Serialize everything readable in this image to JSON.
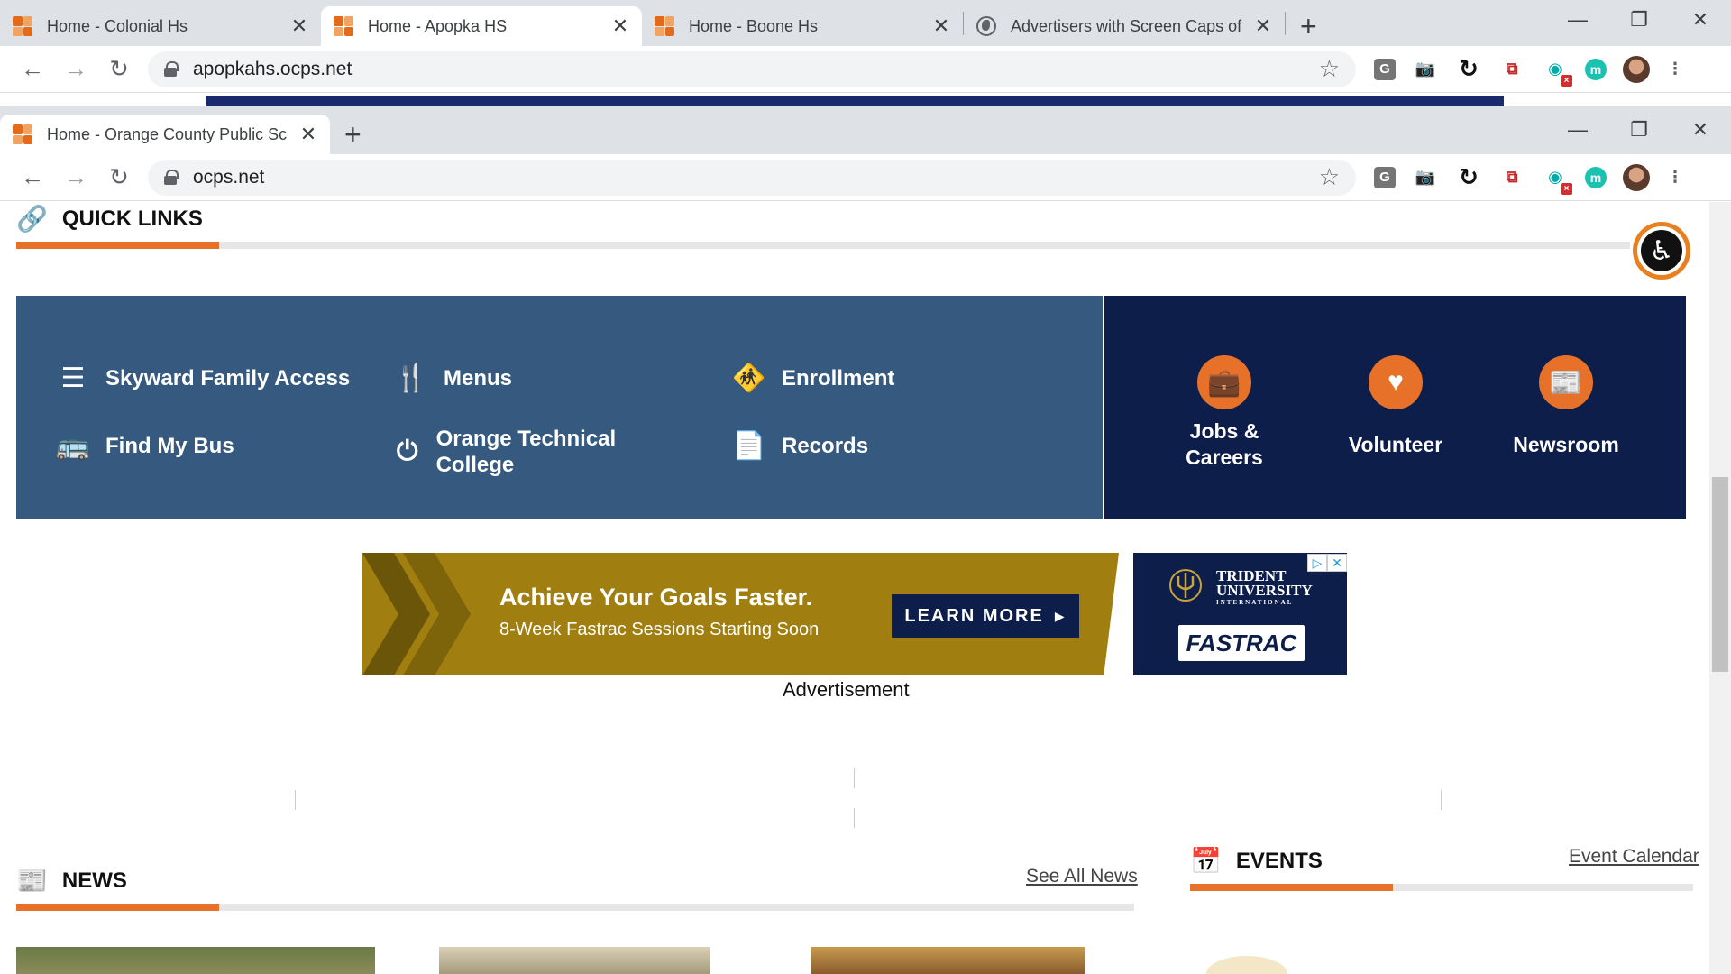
{
  "window1": {
    "tabs": [
      {
        "title": "Home - Colonial Hs",
        "active": false
      },
      {
        "title": "Home - Apopka HS",
        "active": true
      },
      {
        "title": "Home - Boone Hs",
        "active": false
      },
      {
        "title": "Advertisers with Screen Caps of t",
        "active": false
      }
    ],
    "url": "apopkahs.ocps.net"
  },
  "window2": {
    "tabs": [
      {
        "title": "Home - Orange County Public Sc",
        "active": true
      }
    ],
    "url": "ocps.net"
  },
  "icons": {
    "tab_favicon": "ocps-favicon",
    "close": "close-icon",
    "new_tab": "plus-icon",
    "back": "arrow-left-icon",
    "forward": "arrow-right-icon",
    "reload": "reload-icon",
    "lock": "lock-icon",
    "bookmark": "star-icon",
    "minimize": "minimize-icon",
    "restore": "restore-icon",
    "accessibility": "accessibility-icon"
  },
  "extensions": [
    "G",
    "camera",
    "sync",
    "pdf",
    "hotspot",
    "m"
  ],
  "quick_links": {
    "heading": "QUICK LINKS",
    "items": [
      {
        "label": "Skyward Family Access",
        "icon": "list-icon"
      },
      {
        "label": "Menus",
        "icon": "utensils-icon"
      },
      {
        "label": "Enrollment",
        "icon": "child-icon"
      },
      {
        "label": "Find My Bus",
        "icon": "bus-icon"
      },
      {
        "label": "Orange Technical College",
        "icon": "power-icon"
      },
      {
        "label": "Records",
        "icon": "document-icon"
      }
    ],
    "featured": [
      {
        "label": "Jobs & Careers",
        "icon": "briefcase-icon"
      },
      {
        "label": "Volunteer",
        "icon": "heart-icon"
      },
      {
        "label": "Newsroom",
        "icon": "newspaper-icon"
      }
    ]
  },
  "ad": {
    "headline": "Achieve Your Goals Faster.",
    "subline": "8-Week Fastrac Sessions Starting Soon",
    "cta": "LEARN MORE",
    "brand_line1": "TRIDENT",
    "brand_line2": "UNIVERSITY",
    "brand_line3": "INTERNATIONAL",
    "brand_product": "FASTRAC",
    "label": "Advertisement"
  },
  "news": {
    "heading": "NEWS",
    "link": "See All News"
  },
  "events": {
    "heading": "EVENTS",
    "link": "Event Calendar"
  },
  "colors": {
    "accent": "#e8712a",
    "quick_links_bg": "#35597f",
    "navy": "#0e1e4b",
    "ad_gold": "#a07f10"
  }
}
